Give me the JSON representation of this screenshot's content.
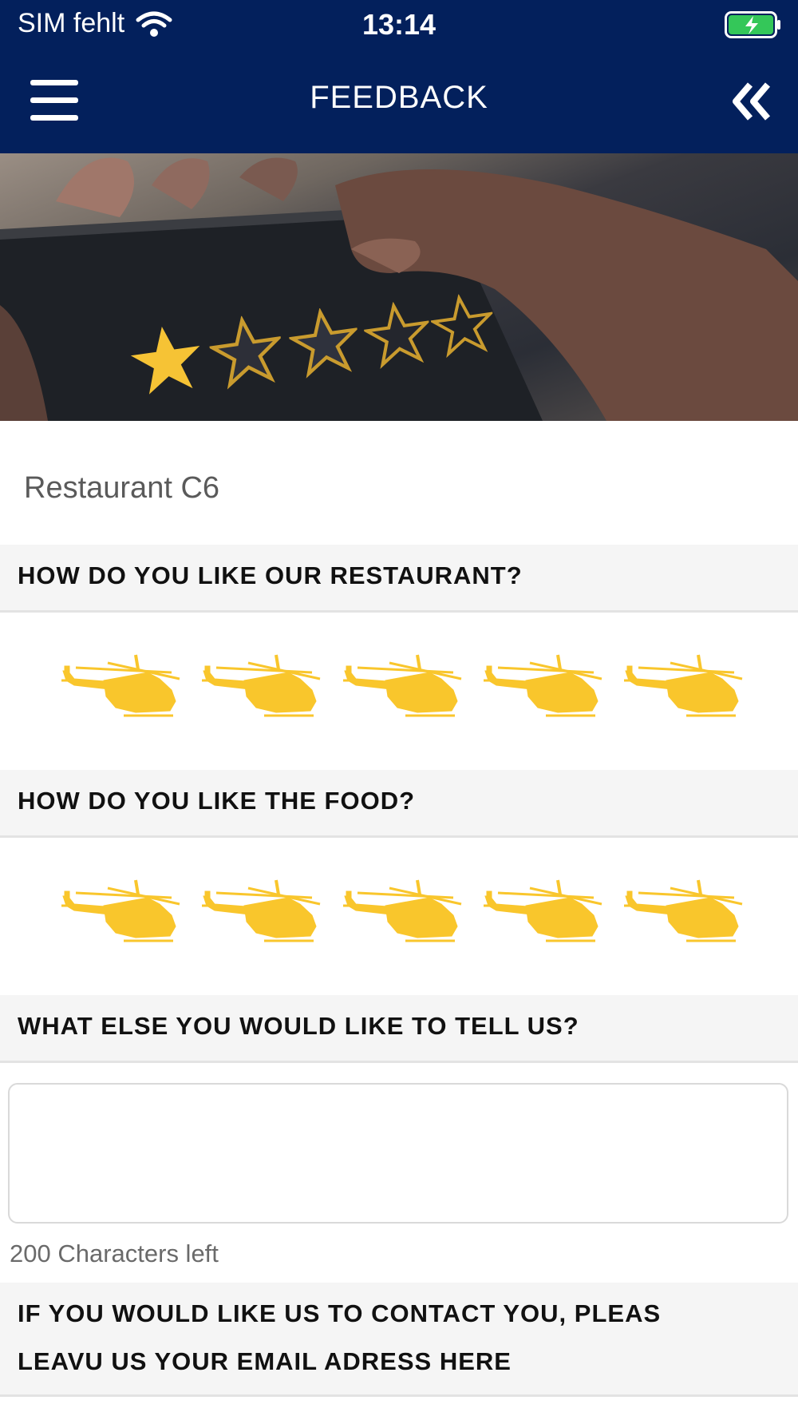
{
  "status_bar": {
    "carrier": "SIM fehlt",
    "time": "13:14",
    "battery_color": "#34c759"
  },
  "header": {
    "title": "FEEDBACK",
    "menu_icon": "hamburger-menu-icon",
    "back_icon": "double-chevron-left-icon",
    "background": "#03205c"
  },
  "hero": {
    "image": "hand-tapping-star-rating-on-phone",
    "stars_total": 5,
    "stars_filled": 1
  },
  "restaurant": {
    "name": "Restaurant C6"
  },
  "questions": [
    {
      "label": "HOW DO YOU LIKE OUR RESTAURANT?",
      "rating": 5,
      "max": 5
    },
    {
      "label": "HOW DO YOU LIKE THE FOOD?",
      "rating": 5,
      "max": 5
    }
  ],
  "comment": {
    "label": "WHAT ELSE YOU WOULD LIKE TO TELL US?",
    "value": "",
    "chars_left": "200 Characters left"
  },
  "contact": {
    "label_line1": "IF YOU WOULD LIKE US TO CONTACT YOU, PLEAS",
    "label_line2": "LEAVU US YOUR EMAIL ADRESS HERE"
  },
  "colors": {
    "accent": "#f9c62c",
    "section_bg": "#f5f5f5"
  }
}
